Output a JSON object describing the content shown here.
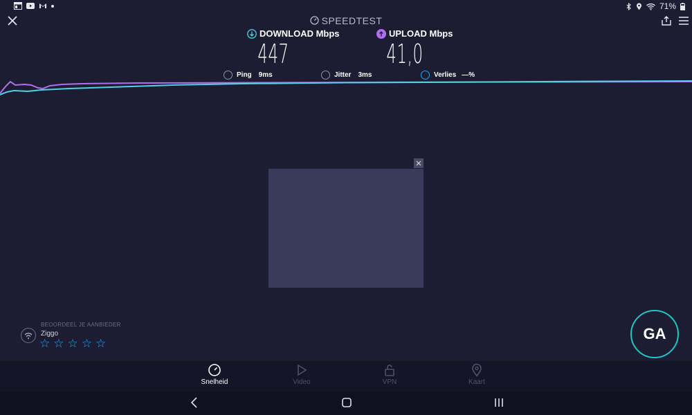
{
  "status_bar": {
    "left_icons": [
      "window-icon",
      "youtube-icon",
      "gmail-icon",
      "dot-icon"
    ],
    "right_icons": [
      "bluetooth-icon",
      "location-icon",
      "wifi-icon"
    ],
    "battery_text": "71%"
  },
  "header": {
    "title": "SPEEDTEST"
  },
  "metrics": {
    "download_label": "DOWNLOAD Mbps",
    "download_value": "447",
    "upload_label": "UPLOAD Mbps",
    "upload_value": "41,0"
  },
  "stats": {
    "ping_label": "Ping",
    "ping_value": "9ms",
    "jitter_label": "Jitter",
    "jitter_value": "3ms",
    "loss_label": "Verlies",
    "loss_value": "—%"
  },
  "provider": {
    "caption": "BEOORDEEL JE AANBIEDER",
    "name": "Ziggo",
    "rating_max": 5,
    "rating": 0
  },
  "go_button": "GA",
  "bottom_tabs": [
    {
      "label": "Snelheid",
      "icon": "speedometer-icon",
      "active": true
    },
    {
      "label": "Video",
      "icon": "play-icon",
      "active": false
    },
    {
      "label": "VPN",
      "icon": "lock-icon",
      "active": false
    },
    {
      "label": "Kaart",
      "icon": "map-pin-icon",
      "active": false
    }
  ],
  "colors": {
    "background": "#1c1d33",
    "download_accent": "#4fd1e0",
    "upload_accent": "#b26ef0",
    "go_ring": "#1fc6c3",
    "star": "#2f9ee8"
  }
}
